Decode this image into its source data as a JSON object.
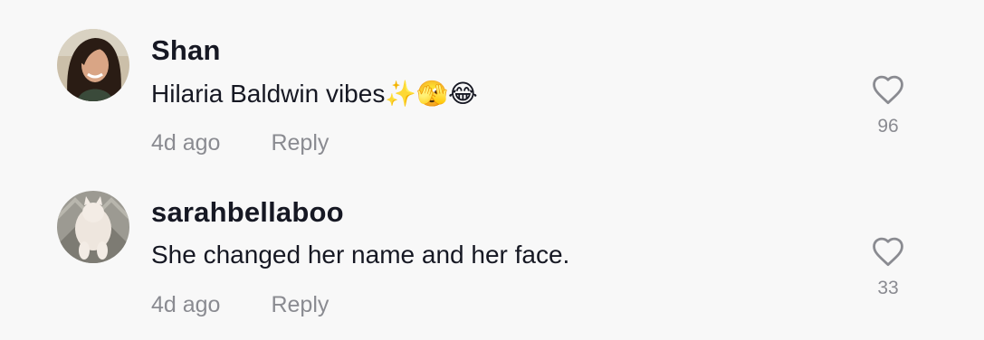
{
  "comments": [
    {
      "username": "Shan",
      "text": "Hilaria Baldwin vibes✨🫣😂",
      "time": "4d ago",
      "reply_label": "Reply",
      "like_count": "96",
      "like_icon": "heart-outline-icon"
    },
    {
      "username": "sarahbellaboo",
      "text": "She changed her name and her face.",
      "time": "4d ago",
      "reply_label": "Reply",
      "like_count": "33",
      "like_icon": "heart-outline-icon"
    }
  ],
  "colors": {
    "background": "#f8f8f8",
    "primary_text": "#161823",
    "secondary_text": "#8a8b91"
  }
}
